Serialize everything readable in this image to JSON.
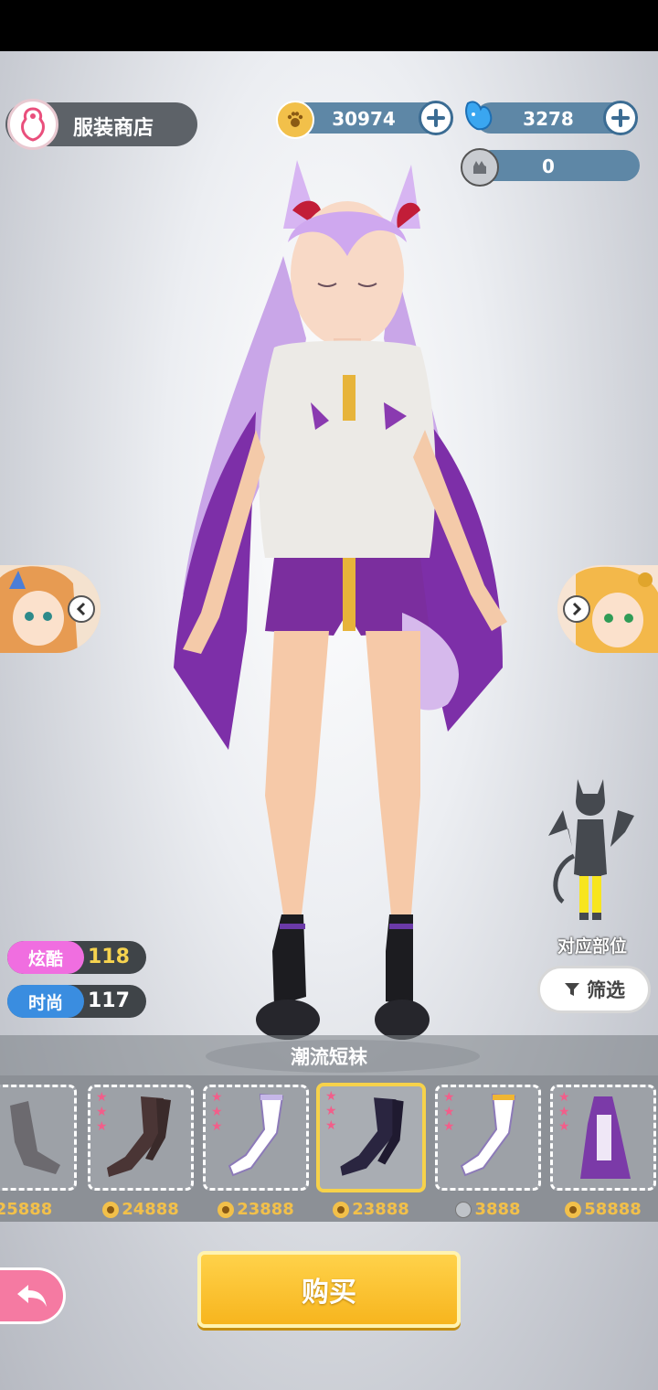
{
  "header": {
    "shop_title": "服装商店"
  },
  "currencies": {
    "coins": "30974",
    "gems": "3278",
    "tokens": "0"
  },
  "stats": {
    "cool_label": "炫酷",
    "cool_value": "118",
    "fashion_label": "时尚",
    "fashion_value": "117"
  },
  "part_indicator": {
    "label": "对应部位",
    "filter_label": "筛选"
  },
  "category": {
    "title": "潮流短袜"
  },
  "items": [
    {
      "name": "stockings-dark",
      "stars": 0,
      "price": "25888",
      "currency": "coin"
    },
    {
      "name": "stockings-brown",
      "stars": 3,
      "price": "24888",
      "currency": "coin"
    },
    {
      "name": "stockings-white",
      "stars": 3,
      "price": "23888",
      "currency": "coin"
    },
    {
      "name": "stockings-navy",
      "stars": 3,
      "price": "23888",
      "currency": "coin",
      "selected": true
    },
    {
      "name": "stockings-white-gold",
      "stars": 3,
      "price": "3888",
      "currency": "token"
    },
    {
      "name": "dress-purple",
      "stars": 3,
      "price": "58888",
      "currency": "coin"
    }
  ],
  "actions": {
    "buy_label": "购买"
  },
  "colors": {
    "currency_bar": "#5e87a6",
    "cool_tag": "#f06ee0",
    "fashion_tag": "#3a8de0",
    "buy_button": "#f7b51e",
    "selected_border": "#f7d24a",
    "star": "#f25e8a"
  }
}
